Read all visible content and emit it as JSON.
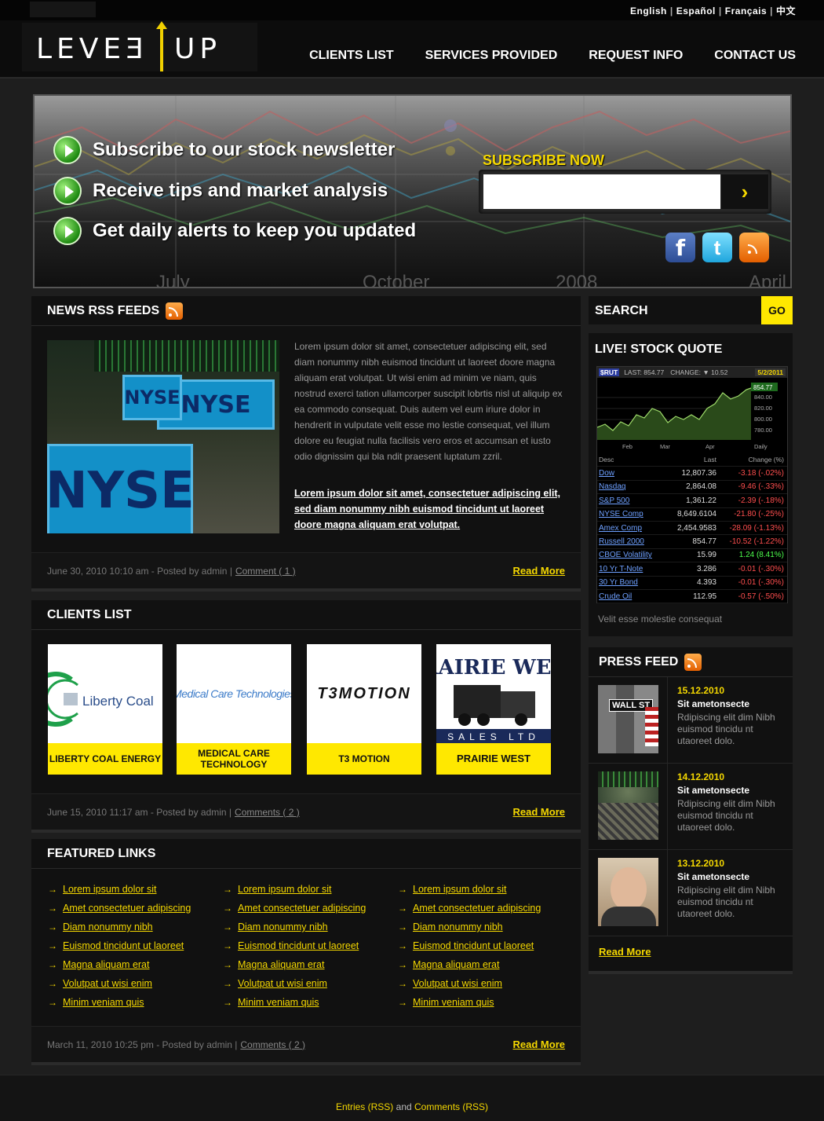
{
  "languages": [
    "English",
    "Español",
    "Français",
    "中文"
  ],
  "logo": {
    "text": "LEVEL UP",
    "left": "LEVEƎ",
    "right": "UP"
  },
  "nav": [
    "CLIENTS LIST",
    "SERVICES PROVIDED",
    "REQUEST INFO",
    "CONTACT US"
  ],
  "banner": {
    "bullets": [
      "Subscribe to our stock newsletter",
      "Receive tips and market analysis",
      "Get daily alerts to keep you updated"
    ],
    "subscribe_label": "SUBSCRIBE NOW",
    "subscribe_button": "›",
    "chart_labels": [
      "July",
      "October",
      "2008",
      "April"
    ],
    "social": {
      "facebook": "f",
      "twitter": "t",
      "rss": "rss"
    }
  },
  "news": {
    "title": "NEWS RSS FEEDS",
    "image_words": [
      "NYSE",
      "NYSE",
      "NYSE"
    ],
    "body": "Lorem ipsum dolor sit amet, consectetuer adipiscing elit, sed diam nonummy nibh euismod tincidunt ut laoreet doore magna aliquam erat volutpat. Ut wisi enim ad minim ve niam, quis nostrud exerci tation ullamcorper suscipit lobrtis nisl ut aliquip ex ea commodo consequat. Duis autem vel eum iriure dolor in hendrerit in vulputate velit esse mo lestie consequat, vel illum dolore eu feugiat nulla facilisis vero eros et accumsan et iusto odio dignissim qui bla ndit praesent luptatum zzril.",
    "link": "Lorem ipsum dolor sit amet, consectetuer adipiscing elit, sed diam nonummy nibh euismod tincidunt ut laoreet doore magna aliquam erat volutpat.",
    "meta": "June 30, 2010 10:10 am - Posted by admin  |",
    "comments": "Comment ( 1 )",
    "read_more": "Read More"
  },
  "clients": {
    "title": "CLIENTS LIST",
    "items": [
      {
        "name": "LIBERTY COAL ENERGY",
        "logo": "Liberty Coal"
      },
      {
        "name": "MEDICAL CARE TECHNOLOGY",
        "logo": "Medical Care Technologies"
      },
      {
        "name": "T3 MOTION",
        "logo": "T3MOTION"
      },
      {
        "name": "PRAIRIE WEST",
        "logo": "PRAIRIE WEST",
        "logo_sub": "SALES LTD"
      }
    ],
    "meta": "June 15, 2010 11:17 am - Posted by admin  |",
    "comments": "Comments ( 2 )",
    "read_more": "Read More"
  },
  "featured": {
    "title": "FEATURED LINKS",
    "links": [
      "Lorem ipsum dolor sit",
      "Amet consectetuer adipiscing",
      "Diam nonummy nibh",
      "Euismod tincidunt ut laoreet",
      "Magna aliquam erat",
      "Volutpat ut wisi enim",
      "Minim veniam quis"
    ],
    "meta": "March 11, 2010 10:25 pm - Posted by admin  |",
    "comments": "Comments ( 2 )",
    "read_more": "Read More"
  },
  "search": {
    "label": "SEARCH",
    "button": "GO"
  },
  "stock": {
    "title": "LIVE! STOCK QUOTE",
    "symbol": "$RUT",
    "last_label": "LAST: 854.77",
    "change_label": "CHANGE: ▼ 10.52",
    "date": "5/2/2011",
    "price_badge": "854.77",
    "y_ticks": [
      "840.00",
      "820.00",
      "800.00",
      "780.00"
    ],
    "x_ticks": [
      "Feb",
      "Mar",
      "Apr",
      "Daily"
    ],
    "columns": [
      "Desc",
      "Last",
      "Change (%)"
    ],
    "rows": [
      {
        "desc": "Dow",
        "last": "12,807.36",
        "change": "-3.18 (-.02%)",
        "dir": "neg"
      },
      {
        "desc": "Nasdaq",
        "last": "2,864.08",
        "change": "-9.46 (-.33%)",
        "dir": "neg"
      },
      {
        "desc": "S&P 500",
        "last": "1,361.22",
        "change": "-2.39 (-.18%)",
        "dir": "neg"
      },
      {
        "desc": "NYSE Comp",
        "last": "8,649.6104",
        "change": "-21.80 (-.25%)",
        "dir": "neg"
      },
      {
        "desc": "Amex Comp",
        "last": "2,454.9583",
        "change": "-28.09 (-1.13%)",
        "dir": "neg"
      },
      {
        "desc": "Russell 2000",
        "last": "854.77",
        "change": "-10.52 (-1.22%)",
        "dir": "neg"
      },
      {
        "desc": "CBOE Volatility",
        "last": "15.99",
        "change": "1.24 (8.41%)",
        "dir": "pos"
      },
      {
        "desc": "10 Yr T-Note",
        "last": "3.286",
        "change": "-0.01 (-.30%)",
        "dir": "neg"
      },
      {
        "desc": "30 Yr Bond",
        "last": "4.393",
        "change": "-0.01 (-.30%)",
        "dir": "neg"
      },
      {
        "desc": "Crude Oil",
        "last": "112.95",
        "change": "-0.57 (-.50%)",
        "dir": "neg"
      }
    ],
    "note": "Velit esse molestie consequat",
    "colors": {
      "negative": "#ff4e4e",
      "positive": "#4dff4d",
      "link": "#6ea0ff"
    }
  },
  "press": {
    "title": "PRESS FEED",
    "items": [
      {
        "date": "15.12.2010",
        "title": "Sit ametonsecte",
        "desc": "Rdipiscing elit dim Nibh euismod tincidu nt utaoreet dolo.",
        "thumb_text": "WALL ST"
      },
      {
        "date": "14.12.2010",
        "title": "Sit ametonsecte",
        "desc": "Rdipiscing elit dim Nibh euismod tincidu nt utaoreet dolo."
      },
      {
        "date": "13.12.2010",
        "title": "Sit ametonsecte",
        "desc": "Rdipiscing elit dim Nibh euismod tincidu nt utaoreet dolo."
      }
    ],
    "read_more": "Read More"
  },
  "footer": {
    "entries": "Entries (RSS)",
    "and": " and ",
    "comments": "Comments (RSS)"
  },
  "colors": {
    "accent": "#f5d800",
    "background": "#1e1e1e",
    "panel": "#111111"
  }
}
